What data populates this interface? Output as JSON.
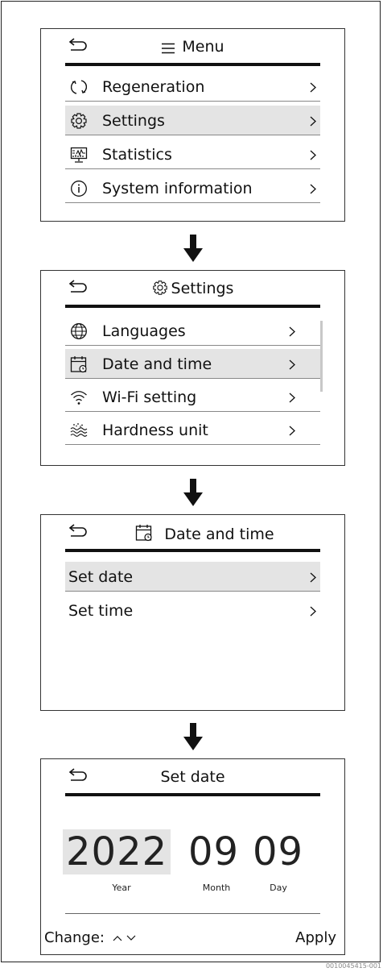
{
  "screen1": {
    "title": "Menu",
    "items": [
      {
        "label": "Regeneration",
        "selected": false
      },
      {
        "label": "Settings",
        "selected": true
      },
      {
        "label": "Statistics",
        "selected": false
      },
      {
        "label": "System information",
        "selected": false
      }
    ]
  },
  "screen2": {
    "title": "Settings",
    "items": [
      {
        "label": "Languages",
        "selected": false
      },
      {
        "label": "Date and time",
        "selected": true
      },
      {
        "label": "Wi-Fi setting",
        "selected": false
      },
      {
        "label": "Hardness unit",
        "selected": false
      }
    ]
  },
  "screen3": {
    "title": "Date and time",
    "items": [
      {
        "label": "Set date",
        "selected": true
      },
      {
        "label": "Set time",
        "selected": false
      }
    ]
  },
  "screen4": {
    "title": "Set date",
    "year": "2022",
    "month": "09",
    "day": "09",
    "year_label": "Year",
    "month_label": "Month",
    "day_label": "Day",
    "change_label": "Change:",
    "apply_label": "Apply"
  },
  "doc_id": "0010045415-001",
  "colors": {
    "selected_row": "#e4e4e4",
    "rule": "#111111"
  },
  "icons": [
    "back-arrow-icon",
    "menu-icon",
    "regeneration-icon",
    "gear-icon",
    "statistics-icon",
    "info-icon",
    "globe-icon",
    "calendar-icon",
    "wifi-icon",
    "hardness-icon",
    "chevron-right-icon",
    "down-arrow-icon",
    "caret-up-icon",
    "caret-down-icon"
  ]
}
